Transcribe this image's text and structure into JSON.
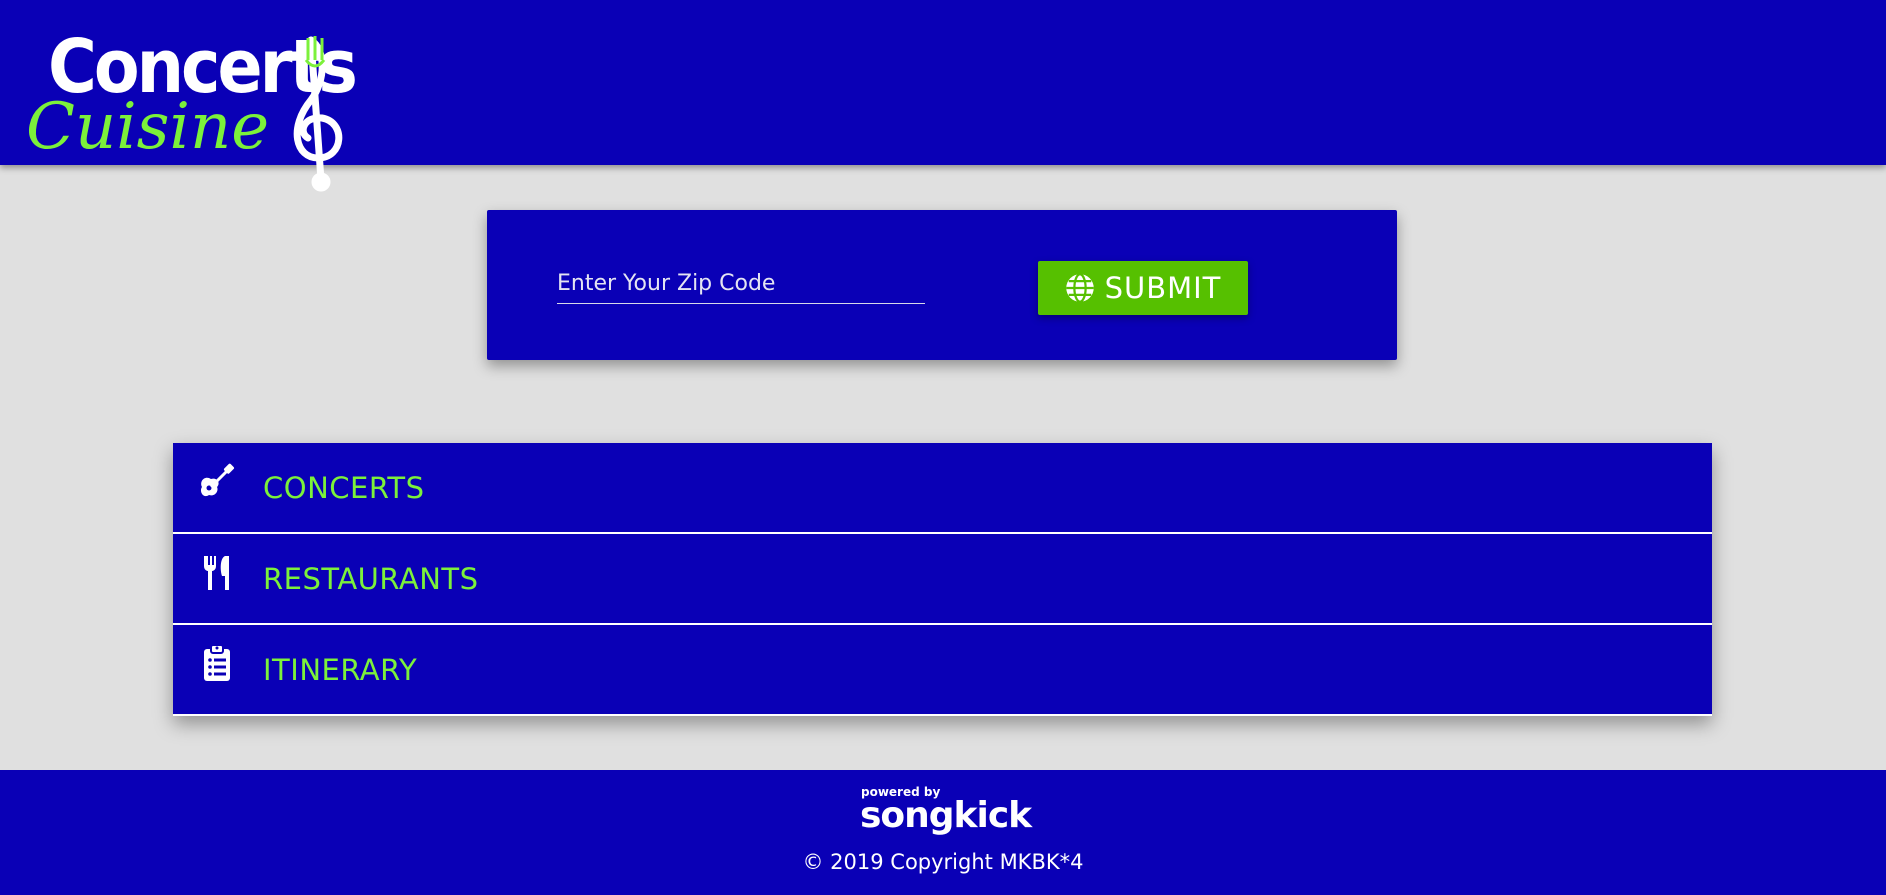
{
  "header": {
    "logo_text_top": "Concerts",
    "logo_text_bottom": "Cuisine"
  },
  "search": {
    "placeholder": "Enter Your Zip Code",
    "value": "",
    "submit_label": "SUBMIT",
    "submit_icon": "globe-icon"
  },
  "nav": {
    "items": [
      {
        "label": "CONCERTS",
        "icon": "guitar-icon"
      },
      {
        "label": "RESTAURANTS",
        "icon": "utensils-icon"
      },
      {
        "label": "ITINERARY",
        "icon": "clipboard-list-icon"
      }
    ]
  },
  "footer": {
    "powered_by": "powered by",
    "brand": "songkick",
    "copyright": "© 2019 Copyright MKBK*4"
  },
  "colors": {
    "primary": "#0a00b6",
    "accent_green": "#56c000",
    "label_green": "#7cf13a",
    "background": "#e0e0e0"
  }
}
